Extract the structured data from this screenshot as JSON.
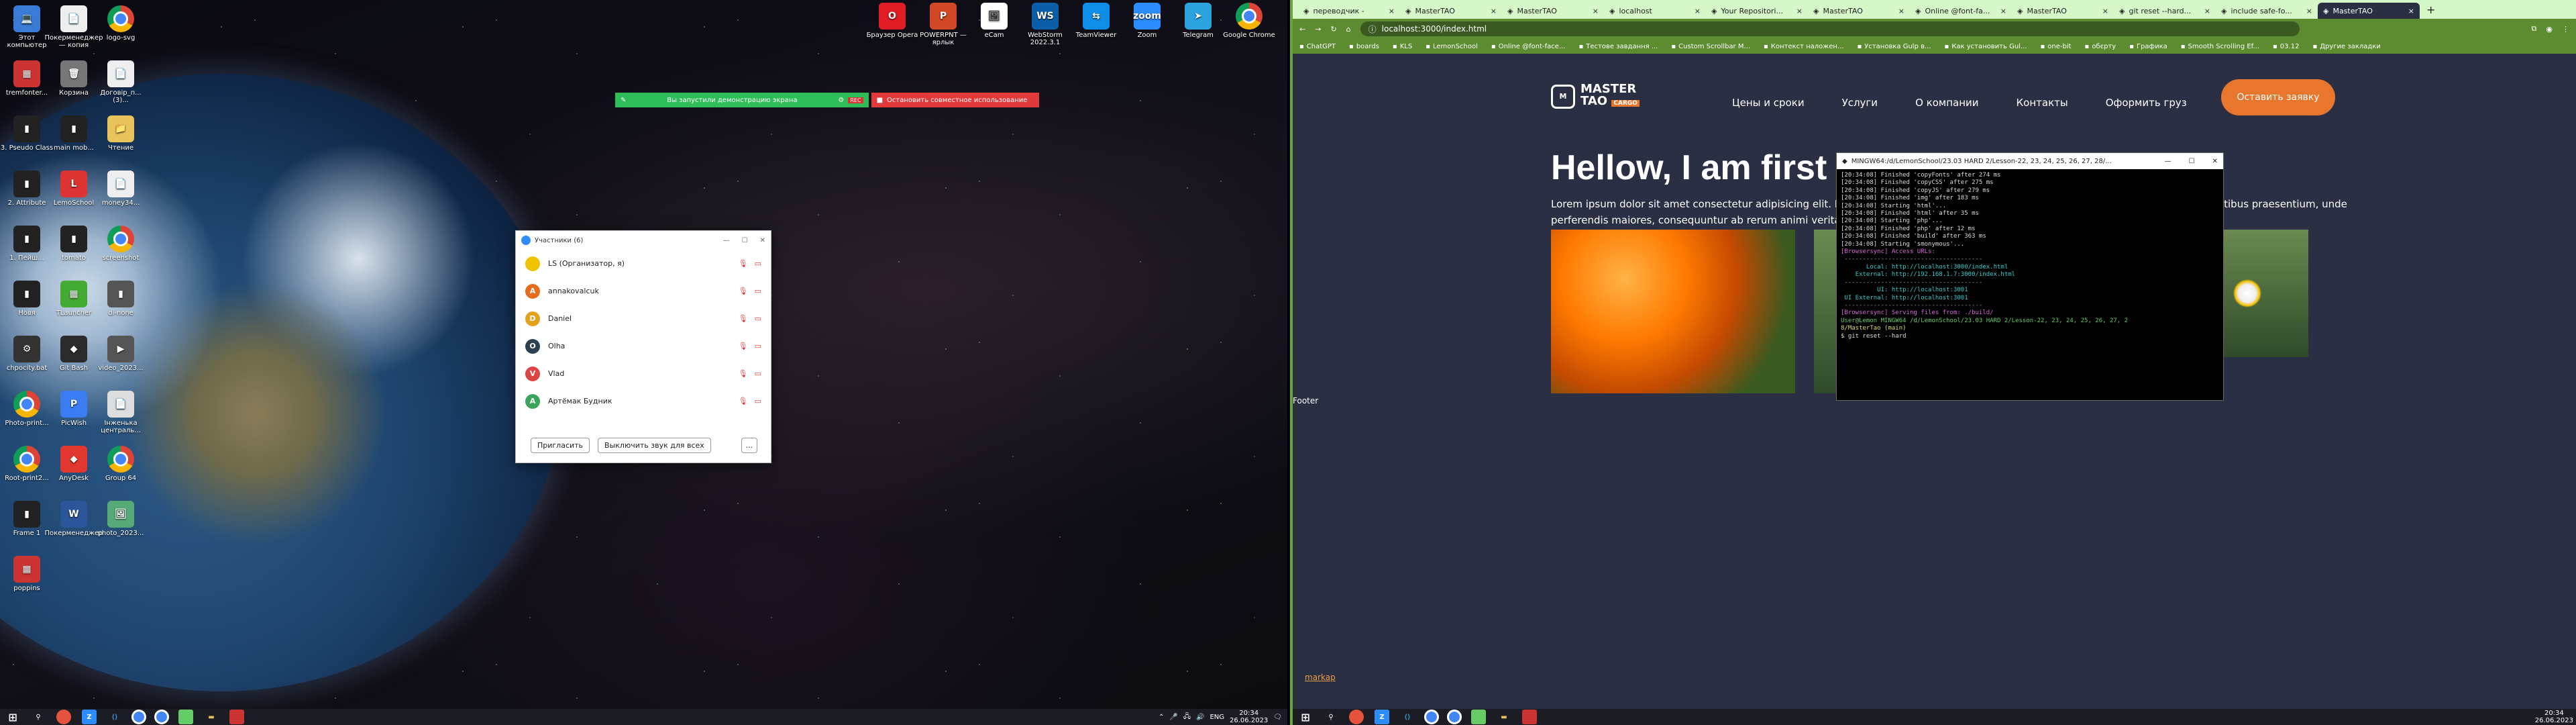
{
  "desktop_left": {
    "icons": [
      {
        "label": "Этот компьютер",
        "color": "#3a7bd5",
        "glyph": "💻"
      },
      {
        "label": "Покерменеджер — копия",
        "color": "#eee",
        "glyph": "📄"
      },
      {
        "label": "logo-svg",
        "color": "chrome",
        "glyph": ""
      },
      {
        "label": "tremfonter...",
        "color": "#c33",
        "glyph": "▦"
      },
      {
        "label": "Корзина",
        "color": "#777",
        "glyph": "🗑"
      },
      {
        "label": "Договір_п... (3)...",
        "color": "#eee",
        "glyph": "📄"
      },
      {
        "label": "3. Pseudo Class",
        "color": "#222",
        "glyph": "▮"
      },
      {
        "label": "main mob...",
        "color": "#222",
        "glyph": "▮"
      },
      {
        "label": "Чтение",
        "color": "#e8c25a",
        "glyph": "📁"
      },
      {
        "label": "2. Attribute",
        "color": "#222",
        "glyph": "▮"
      },
      {
        "label": "LemoSchool",
        "color": "#d33",
        "glyph": "L"
      },
      {
        "label": "money34...",
        "color": "#eee",
        "glyph": "📄"
      },
      {
        "label": "1. Пейш...",
        "color": "#222",
        "glyph": "▮"
      },
      {
        "label": "tomato",
        "color": "#222",
        "glyph": "▮"
      },
      {
        "label": "screenshot",
        "color": "chrome",
        "glyph": ""
      },
      {
        "label": "Новя",
        "color": "#222",
        "glyph": "▮"
      },
      {
        "label": "TLauncher",
        "color": "#4a3",
        "glyph": "▦"
      },
      {
        "label": "di-none",
        "color": "#555",
        "glyph": "▮"
      },
      {
        "label": "chpocity.bat",
        "color": "#333",
        "glyph": "⚙"
      },
      {
        "label": "Git Bash",
        "color": "#2b2b2b",
        "glyph": "◆"
      },
      {
        "label": "video_2023...",
        "color": "#555",
        "glyph": "▶"
      },
      {
        "label": "Photo-print...",
        "color": "chrome",
        "glyph": ""
      },
      {
        "label": "PicWish",
        "color": "#3b7cf3",
        "glyph": "P"
      },
      {
        "label": "Інженька централь...",
        "color": "#ddd",
        "glyph": "📄"
      },
      {
        "label": "Root-print2...",
        "color": "chrome",
        "glyph": ""
      },
      {
        "label": "AnyDesk",
        "color": "#e2372f",
        "glyph": "◆"
      },
      {
        "label": "Group 64",
        "color": "chrome",
        "glyph": ""
      },
      {
        "label": "Frame 1",
        "color": "#222",
        "glyph": "▮"
      },
      {
        "label": "Покерменеджер",
        "color": "#2b579a",
        "glyph": "W"
      },
      {
        "label": "photo_2023...",
        "color": "#5a7",
        "glyph": "🖼"
      },
      {
        "label": "poppins",
        "color": "#c33",
        "glyph": "▦"
      }
    ],
    "top_icons": [
      {
        "label": "Браузер Opera",
        "color": "#e01c24",
        "glyph": "O"
      },
      {
        "label": "POWERPNT — ярлык",
        "color": "#d24726",
        "glyph": "P"
      },
      {
        "label": "eCam",
        "color": "#fff",
        "glyph": "🖼"
      },
      {
        "label": "WebStorm 2022.3.1",
        "color": "#0a5fa8",
        "glyph": "WS"
      },
      {
        "label": "TeamViewer",
        "color": "#0e8ee9",
        "glyph": "⇆"
      },
      {
        "label": "Zoom",
        "color": "#2d8cff",
        "glyph": "zoom"
      },
      {
        "label": "Telegram",
        "color": "#2aa3df",
        "glyph": "➤"
      },
      {
        "label": "Google Chrome",
        "color": "chrome",
        "glyph": ""
      }
    ],
    "zoom_share_bar": {
      "status": "Вы запустили демонстрацию экрана",
      "stop": "Остановить совместное использование",
      "rec": "REC"
    },
    "participants": {
      "title": "Участники (6)",
      "rows": [
        {
          "name": "LS (Организатор, я)",
          "initial": "",
          "color": "#f0c300"
        },
        {
          "name": "annakovalcuk",
          "initial": "A",
          "color": "#e46c1c"
        },
        {
          "name": "Daniel",
          "initial": "D",
          "color": "#e4a21c"
        },
        {
          "name": "Olha",
          "initial": "O",
          "color": "#2e4150"
        },
        {
          "name": "Vlad",
          "initial": "V",
          "color": "#d44"
        },
        {
          "name": "Артёмак Будник",
          "initial": "A",
          "color": "#3ba55c"
        }
      ],
      "invite": "Пригласить",
      "mute_all": "Выключить звук для всех",
      "more": "..."
    },
    "taskbar": {
      "lang": "ENG",
      "time": "20:34",
      "date": "26.06.2023"
    }
  },
  "browser": {
    "tabs": [
      "переводчик -",
      "MasterTAO",
      "MasterTAO",
      "localhost",
      "Your Repositori...",
      "MasterTAO",
      "Online @font-fa...",
      "MasterTAO",
      "git reset --hard...",
      "include safe-fo...",
      "MasterTAO"
    ],
    "active_tab": 10,
    "url": "localhost:3000/index.html",
    "bookmarks": [
      "ChatGPT",
      "boards",
      "KLS",
      "LemonSchool",
      "Online @font-face...",
      "Тестове завдання ...",
      "Custom Scrollbar M...",
      "Контекст наложен...",
      "Установка Gulp в...",
      "Как установить Gul...",
      "one-bit",
      "обєрту",
      "Графика",
      "Smooth Scrolling Ef...",
      "03.12",
      "Другие закладки"
    ]
  },
  "site": {
    "logo_top": "MASTER",
    "logo_bottom": "TAO",
    "logo_badge": "CARGO",
    "nav": [
      "Цены и сроки",
      "Услуги",
      "О компании",
      "Контакты",
      "Оформить груз"
    ],
    "cta": "Оставить заявку",
    "title": "Hellow, I am first",
    "text": "Lorem ipsum dolor sit amet consectetur adipisicing elit. Deleniti, consequuntur ab rerum animi veritatis nesciunt. Sint, officia voluptatibus praesentium, unde perferendis maiores, consequuntur ab rerum animi veritatis nesciunt. Sint",
    "footer": "Footer",
    "marker": "markap"
  },
  "terminal": {
    "title": "MINGW64:/d/LemonSchool/23.03 HARD 2/Lesson-22, 23, 24, 25, 26, 27, 28/...",
    "lines": [
      "[20:34:08] Finished 'copyFonts' after 274 ms",
      "[20:34:08] Finished 'copyCSS' after 275 ms",
      "[20:34:08] Finished 'copyJS' after 279 ms",
      "[20:34:08] Finished 'img' after 183 ms",
      "[20:34:08] Starting 'html'...",
      "[20:34:08] Finished 'html' after 35 ms",
      "[20:34:08] Starting 'php'...",
      "[20:34:08] Finished 'php' after 12 ms",
      "[20:34:08] Finished 'build' after 363 ms",
      "[20:34:08] Starting 'smonymous'...",
      "[Browsersync] Access URLs:",
      " --------------------------------------",
      "       Local: http://localhost:3000/index.html",
      "    External: http://192.168.1.7:3000/index.html",
      " --------------------------------------",
      "          UI: http://localhost:3001",
      " UI External: http://localhost:3001",
      " --------------------------------------",
      "[Browsersync] Serving files from: ./build/",
      "",
      "User@Lemon MINGW64 /d/LemonSchool/23.03 HARD 2/Lesson-22, 23, 24, 25, 26, 27, 2",
      "8/MasterTao (main)",
      "$ git reset --hard"
    ]
  },
  "taskbar_right": {
    "time": "20:34",
    "date": "26.06.2023"
  }
}
